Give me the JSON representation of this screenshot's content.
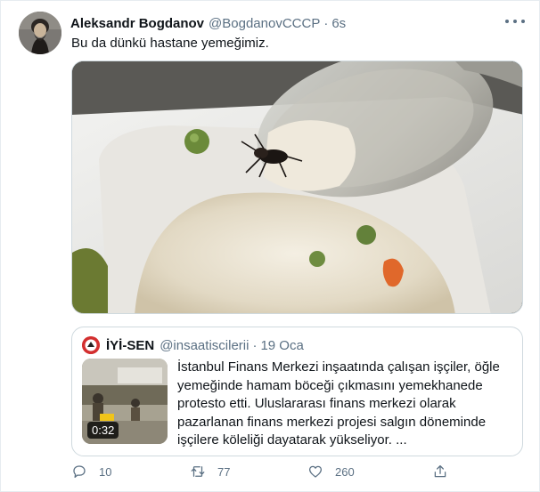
{
  "tweet": {
    "author_name": "Aleksandr Bogdanov",
    "author_handle": "@BogdanovCCCP",
    "separator": "·",
    "time": "6s",
    "text": "Bu da dünkü hastane yemeğimiz."
  },
  "quoted_tweet": {
    "author_name": "İYİ-SEN",
    "author_handle": "@insaatiscilerii",
    "separator": "·",
    "time": "19 Oca",
    "video_duration": "0:32",
    "text_lines": [
      "İstanbul Finans Merkezi inşaatında çalışan işçiler, öğle",
      "yemeğinde hamam böceği çıkmasını yemekhanede",
      "protesto etti. Uluslararası finans merkezi olarak",
      "pazarlanan finans merkezi projesi salgın döneminde",
      "işçilere köleliği dayatarak yükseliyor. ..."
    ]
  },
  "actions": {
    "reply_count": "10",
    "retweet_count": "77",
    "like_count": "260"
  },
  "icons": {
    "reply": "reply-icon",
    "retweet": "retweet-icon",
    "like": "heart-icon",
    "share": "share-icon",
    "more": "more-options-icon"
  },
  "colors": {
    "text_primary": "#0f1419",
    "text_secondary": "#5b7083",
    "border": "#cfd9de",
    "quote_avatar_red": "#d32f2f"
  }
}
